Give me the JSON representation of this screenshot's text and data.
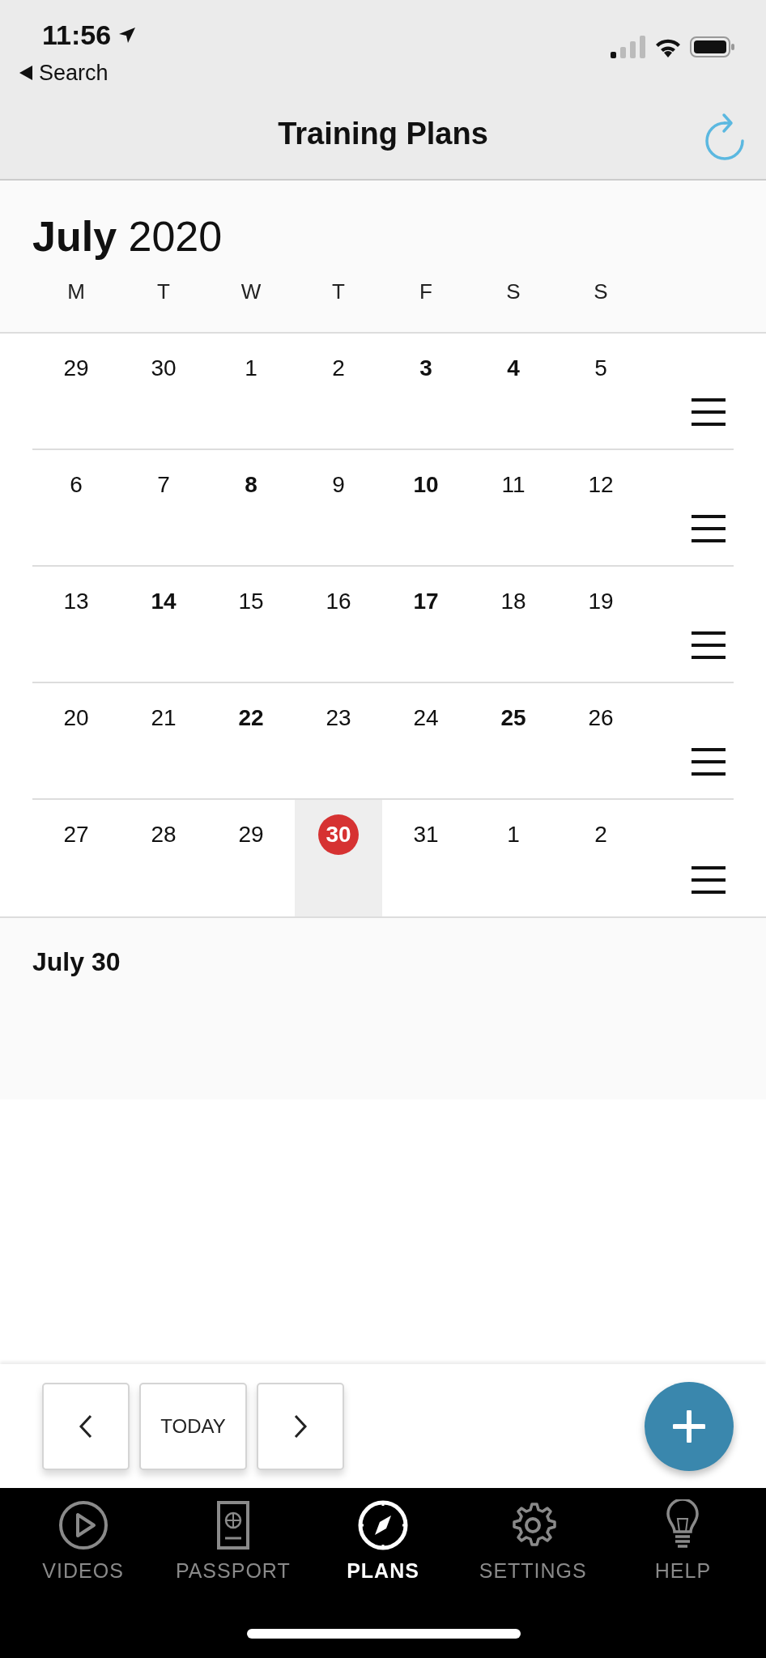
{
  "status_bar": {
    "time": "11:56",
    "back_label": "Search"
  },
  "header": {
    "title": "Training Plans"
  },
  "calendar": {
    "month": "July",
    "year": "2020",
    "weekdays": [
      "M",
      "T",
      "W",
      "T",
      "F",
      "S",
      "S"
    ],
    "weeks": [
      {
        "days": [
          {
            "label": "29",
            "bold": false,
            "today": false,
            "selected": false
          },
          {
            "label": "30",
            "bold": false,
            "today": false,
            "selected": false
          },
          {
            "label": "1",
            "bold": false,
            "today": false,
            "selected": false
          },
          {
            "label": "2",
            "bold": false,
            "today": false,
            "selected": false
          },
          {
            "label": "3",
            "bold": true,
            "today": false,
            "selected": false
          },
          {
            "label": "4",
            "bold": true,
            "today": false,
            "selected": false
          },
          {
            "label": "5",
            "bold": false,
            "today": false,
            "selected": false
          }
        ]
      },
      {
        "days": [
          {
            "label": "6",
            "bold": false,
            "today": false,
            "selected": false
          },
          {
            "label": "7",
            "bold": false,
            "today": false,
            "selected": false
          },
          {
            "label": "8",
            "bold": true,
            "today": false,
            "selected": false
          },
          {
            "label": "9",
            "bold": false,
            "today": false,
            "selected": false
          },
          {
            "label": "10",
            "bold": true,
            "today": false,
            "selected": false
          },
          {
            "label": "11",
            "bold": false,
            "today": false,
            "selected": false
          },
          {
            "label": "12",
            "bold": false,
            "today": false,
            "selected": false
          }
        ]
      },
      {
        "days": [
          {
            "label": "13",
            "bold": false,
            "today": false,
            "selected": false
          },
          {
            "label": "14",
            "bold": true,
            "today": false,
            "selected": false
          },
          {
            "label": "15",
            "bold": false,
            "today": false,
            "selected": false
          },
          {
            "label": "16",
            "bold": false,
            "today": false,
            "selected": false
          },
          {
            "label": "17",
            "bold": true,
            "today": false,
            "selected": false
          },
          {
            "label": "18",
            "bold": false,
            "today": false,
            "selected": false
          },
          {
            "label": "19",
            "bold": false,
            "today": false,
            "selected": false
          }
        ]
      },
      {
        "days": [
          {
            "label": "20",
            "bold": false,
            "today": false,
            "selected": false
          },
          {
            "label": "21",
            "bold": false,
            "today": false,
            "selected": false
          },
          {
            "label": "22",
            "bold": true,
            "today": false,
            "selected": false
          },
          {
            "label": "23",
            "bold": false,
            "today": false,
            "selected": false
          },
          {
            "label": "24",
            "bold": false,
            "today": false,
            "selected": false
          },
          {
            "label": "25",
            "bold": true,
            "today": false,
            "selected": false
          },
          {
            "label": "26",
            "bold": false,
            "today": false,
            "selected": false
          }
        ]
      },
      {
        "days": [
          {
            "label": "27",
            "bold": false,
            "today": false,
            "selected": false
          },
          {
            "label": "28",
            "bold": false,
            "today": false,
            "selected": false
          },
          {
            "label": "29",
            "bold": false,
            "today": false,
            "selected": false
          },
          {
            "label": "30",
            "bold": true,
            "today": true,
            "selected": true
          },
          {
            "label": "31",
            "bold": false,
            "today": false,
            "selected": false
          },
          {
            "label": "1",
            "bold": false,
            "today": false,
            "selected": false
          },
          {
            "label": "2",
            "bold": false,
            "today": false,
            "selected": false
          }
        ]
      }
    ]
  },
  "selected_day": {
    "title": "July 30"
  },
  "toolbar": {
    "today_label": "TODAY"
  },
  "tabs": [
    {
      "label": "VIDEOS",
      "kind": "play",
      "selected": false
    },
    {
      "label": "PASSPORT",
      "kind": "passport",
      "selected": false
    },
    {
      "label": "PLANS",
      "kind": "compass",
      "selected": true
    },
    {
      "label": "SETTINGS",
      "kind": "gear",
      "selected": false
    },
    {
      "label": "HELP",
      "kind": "bulb",
      "selected": false
    }
  ]
}
